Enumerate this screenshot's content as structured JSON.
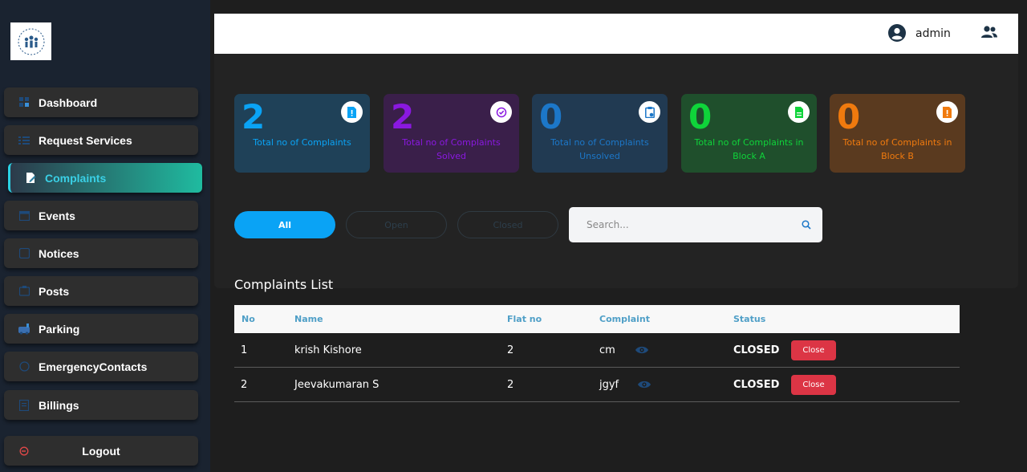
{
  "header": {
    "user_name": "admin"
  },
  "sidebar": {
    "items": [
      {
        "label": "Dashboard"
      },
      {
        "label": "Request Services"
      },
      {
        "label": "Complaints"
      },
      {
        "label": "Events"
      },
      {
        "label": "Notices"
      },
      {
        "label": "Posts"
      },
      {
        "label": "Parking"
      },
      {
        "label": "EmergencyContacts"
      },
      {
        "label": "Billings"
      }
    ],
    "logout_label": "Logout",
    "active_item": "Complaints"
  },
  "cards": [
    {
      "value": "2",
      "label": "Total no of Complaints",
      "color": "#0aa3f5",
      "bg": "#1f4158"
    },
    {
      "value": "2",
      "label": "Total no of Complaints Solved",
      "color": "#8a18e0",
      "bg": "#3a1f4a"
    },
    {
      "value": "0",
      "label": "Total no of Complaints Unsolved",
      "color": "#1c77c8",
      "bg": "#213a52"
    },
    {
      "value": "0",
      "label": "Total no of Complaints in Block A",
      "color": "#0fd43a",
      "bg": "#1f4f2c"
    },
    {
      "value": "0",
      "label": "Total no of Complaints in Block B",
      "color": "#f07a0e",
      "bg": "#5a3a1f"
    }
  ],
  "filters": {
    "all": "All",
    "open": "Open",
    "closed": "Closed"
  },
  "search": {
    "placeholder": "Search..."
  },
  "list_title": "Complaints List",
  "table": {
    "headers": {
      "no": "No",
      "name": "Name",
      "flat": "Flat no",
      "complaint": "Complaint",
      "status": "Status"
    },
    "rows": [
      {
        "no": "1",
        "name": "krish Kishore",
        "flat": "2",
        "complaint": "cm",
        "status": "CLOSED",
        "action": "Close"
      },
      {
        "no": "2",
        "name": "Jeevakumaran S",
        "flat": "2",
        "complaint": "jgyf",
        "status": "CLOSED",
        "action": "Close"
      }
    ]
  }
}
